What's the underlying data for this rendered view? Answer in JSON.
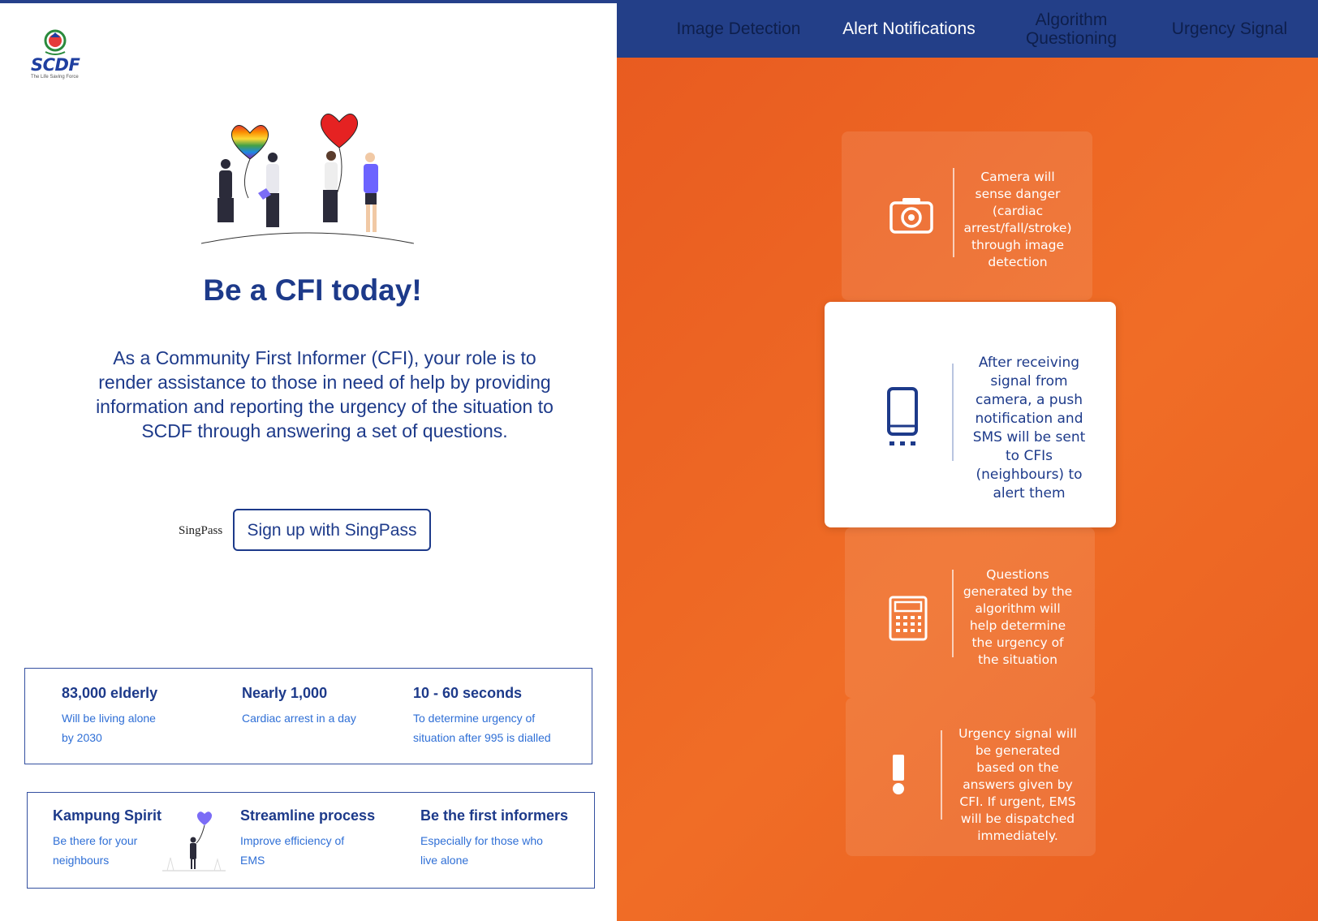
{
  "left": {
    "logo": {
      "text": "SCDF",
      "tagline": "The Life Saving Force"
    },
    "title": "Be a CFI today!",
    "intro": "As a Community First Informer (CFI), your role is to render assistance to those in need of help by providing information and reporting the urgency of the situation to SCDF through answering a set of questions.",
    "singpass_logo": "SingPass",
    "signup_button": "Sign up with SingPass",
    "stats": [
      {
        "heading": "83,000 elderly",
        "sub1": "Will be living alone",
        "sub2": "by 2030"
      },
      {
        "heading": "Nearly 1,000",
        "sub1": "Cardiac arrest in a day",
        "sub2": ""
      },
      {
        "heading": "10 - 60 seconds",
        "sub1": "To determine urgency of",
        "sub2": "situation after 995 is dialled"
      }
    ],
    "values": [
      {
        "heading": "Kampung Spirit",
        "sub1": "Be there for your",
        "sub2": "neighbours"
      },
      {
        "heading": "Streamline process",
        "sub1": "Improve efficiency of",
        "sub2": "EMS"
      },
      {
        "heading": "Be the first informers",
        "sub1": "Especially for those who",
        "sub2": "live alone"
      }
    ]
  },
  "nav": {
    "items": [
      {
        "label": "Image Detection",
        "active": false
      },
      {
        "label": "Alert Notifications",
        "active": true
      },
      {
        "label": "Algorithm Questioning",
        "active": false
      },
      {
        "label": "Urgency Signal",
        "active": false
      }
    ]
  },
  "cards": [
    {
      "icon": "camera-icon",
      "text": "Camera will sense danger (cardiac arrest/fall/stroke) through image detection"
    },
    {
      "icon": "smartphone-icon",
      "text": "After receiving signal from camera, a push notification and SMS will be sent to CFIs (neighbours) to alert them"
    },
    {
      "icon": "calculator-icon",
      "text": "Questions generated by the algorithm will help determine the urgency of the situation"
    },
    {
      "icon": "exclamation-icon",
      "text": "Urgency signal will be generated based on the answers given by CFI. If urgent, EMS will be dispatched immediately."
    }
  ],
  "colors": {
    "brand_blue": "#233f88",
    "orange": "#ec6224",
    "link_blue": "#2f6fd6"
  }
}
